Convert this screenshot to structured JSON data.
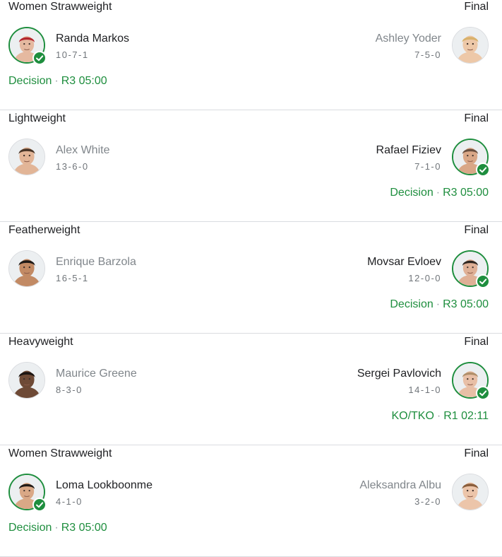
{
  "fights": [
    {
      "division": "Women Strawweight",
      "status": "Final",
      "winner_side": "left",
      "fighter_left": {
        "name": "Randa Markos",
        "record": "10-7-1",
        "skin": "#e5b9a0",
        "hair": "#b3262e"
      },
      "fighter_right": {
        "name": "Ashley Yoder",
        "record": "7-5-0",
        "skin": "#edc8a8",
        "hair": "#d9b26c"
      },
      "result": {
        "method": "Decision",
        "time": "R3 05:00"
      }
    },
    {
      "division": "Lightweight",
      "status": "Final",
      "winner_side": "right",
      "fighter_left": {
        "name": "Alex White",
        "record": "13-6-0",
        "skin": "#e2b597",
        "hair": "#4a3628"
      },
      "fighter_right": {
        "name": "Rafael Fiziev",
        "record": "7-1-0",
        "skin": "#d9a787",
        "hair": "#6b5040"
      },
      "result": {
        "method": "Decision",
        "time": "R3 05:00"
      }
    },
    {
      "division": "Featherweight",
      "status": "Final",
      "winner_side": "right",
      "fighter_left": {
        "name": "Enrique Barzola",
        "record": "16-5-1",
        "skin": "#c28a64",
        "hair": "#1f1a17"
      },
      "fighter_right": {
        "name": "Movsar Evloev",
        "record": "12-0-0",
        "skin": "#dfb096",
        "hair": "#2d2520"
      },
      "result": {
        "method": "Decision",
        "time": "R3 05:00"
      }
    },
    {
      "division": "Heavyweight",
      "status": "Final",
      "winner_side": "right",
      "fighter_left": {
        "name": "Maurice Greene",
        "record": "8-3-0",
        "skin": "#6e4a36",
        "hair": "#1c1512"
      },
      "fighter_right": {
        "name": "Sergei Pavlovich",
        "record": "14-1-0",
        "skin": "#e8bfa6",
        "hair": "#b08f6a"
      },
      "result": {
        "method": "KO/TKO",
        "time": "R1 02:11"
      }
    },
    {
      "division": "Women Strawweight",
      "status": "Final",
      "winner_side": "left",
      "fighter_left": {
        "name": "Loma Lookboonme",
        "record": "4-1-0",
        "skin": "#d9a886",
        "hair": "#1f1a17"
      },
      "fighter_right": {
        "name": "Aleksandra Albu",
        "record": "3-2-0",
        "skin": "#ecc5aa",
        "hair": "#8a5e3c"
      },
      "result": {
        "method": "Decision",
        "time": "R3 05:00"
      }
    }
  ]
}
